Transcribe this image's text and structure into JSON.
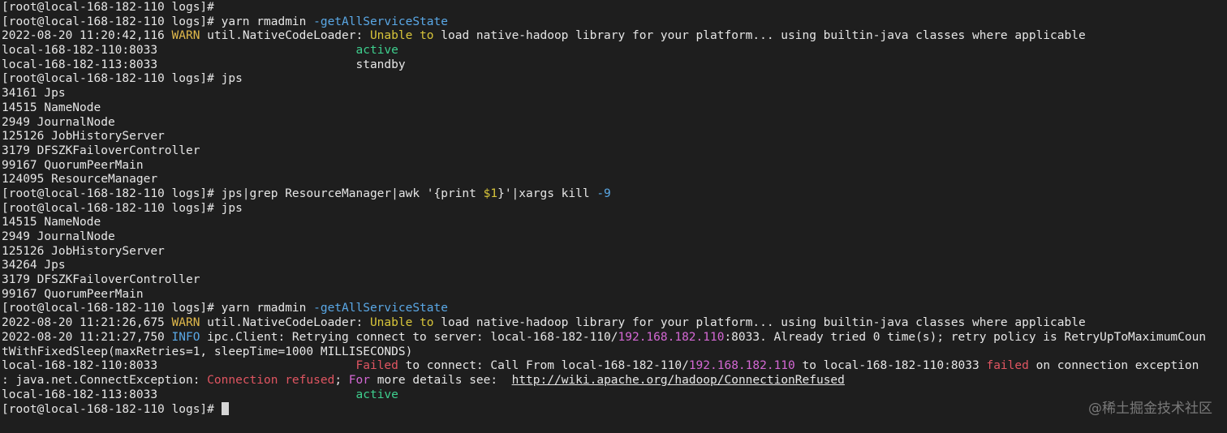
{
  "terminal": {
    "colors": {
      "background": "#1e1e1e",
      "text": "#e6e6e6",
      "warn": "#e0b84b",
      "flag": "#5aa8e6",
      "yellow": "#d8c53a",
      "green": "#3ecf8e",
      "magenta": "#d468d4",
      "red": "#e05561"
    },
    "lines": [
      [
        {
          "t": "[root@local-168-182-110 logs]#",
          "c": "default"
        }
      ],
      [
        {
          "t": "[root@local-168-182-110 logs]# yarn rmadmin ",
          "c": "default"
        },
        {
          "t": "-getAllServiceState",
          "c": "flag"
        }
      ],
      [
        {
          "t": "2022-08-20 11:20:42,116 ",
          "c": "default"
        },
        {
          "t": "WARN",
          "c": "warn"
        },
        {
          "t": " util.NativeCodeLoader: ",
          "c": "default"
        },
        {
          "t": "Unable",
          "c": "yellow"
        },
        {
          "t": " ",
          "c": "default"
        },
        {
          "t": "to",
          "c": "yellow"
        },
        {
          "t": " load native-hadoop library for your platform... using builtin-java classes where applicable",
          "c": "default"
        }
      ],
      [
        {
          "t": "local-168-182-110:8033                            ",
          "c": "default"
        },
        {
          "t": "active",
          "c": "green"
        }
      ],
      [
        {
          "t": "local-168-182-113:8033                            standby",
          "c": "default"
        }
      ],
      [
        {
          "t": "[root@local-168-182-110 logs]# jps",
          "c": "default"
        }
      ],
      [
        {
          "t": "34161 Jps",
          "c": "default"
        }
      ],
      [
        {
          "t": "14515 NameNode",
          "c": "default"
        }
      ],
      [
        {
          "t": "2949 JournalNode",
          "c": "default"
        }
      ],
      [
        {
          "t": "125126 JobHistoryServer",
          "c": "default"
        }
      ],
      [
        {
          "t": "3179 DFSZKFailoverController",
          "c": "default"
        }
      ],
      [
        {
          "t": "99167 QuorumPeerMain",
          "c": "default"
        }
      ],
      [
        {
          "t": "124095 ResourceManager",
          "c": "default"
        }
      ],
      [
        {
          "t": "[root@local-168-182-110 logs]# jps|grep ResourceManager|awk '{print ",
          "c": "default"
        },
        {
          "t": "$1",
          "c": "yellow"
        },
        {
          "t": "}'|xargs kill ",
          "c": "default"
        },
        {
          "t": "-9",
          "c": "flag"
        }
      ],
      [
        {
          "t": "[root@local-168-182-110 logs]# jps",
          "c": "default"
        }
      ],
      [
        {
          "t": "14515 NameNode",
          "c": "default"
        }
      ],
      [
        {
          "t": "2949 JournalNode",
          "c": "default"
        }
      ],
      [
        {
          "t": "125126 JobHistoryServer",
          "c": "default"
        }
      ],
      [
        {
          "t": "34264 Jps",
          "c": "default"
        }
      ],
      [
        {
          "t": "3179 DFSZKFailoverController",
          "c": "default"
        }
      ],
      [
        {
          "t": "99167 QuorumPeerMain",
          "c": "default"
        }
      ],
      [
        {
          "t": "[root@local-168-182-110 logs]# yarn rmadmin ",
          "c": "default"
        },
        {
          "t": "-getAllServiceState",
          "c": "flag"
        }
      ],
      [
        {
          "t": "2022-08-20 11:21:26,675 ",
          "c": "default"
        },
        {
          "t": "WARN",
          "c": "warn"
        },
        {
          "t": " util.NativeCodeLoader: ",
          "c": "default"
        },
        {
          "t": "Unable",
          "c": "yellow"
        },
        {
          "t": " ",
          "c": "default"
        },
        {
          "t": "to",
          "c": "yellow"
        },
        {
          "t": " load native-hadoop library for your platform... using builtin-java classes where applicable",
          "c": "default"
        }
      ],
      [
        {
          "t": "2022-08-20 11:21:27,750 ",
          "c": "default"
        },
        {
          "t": "INFO",
          "c": "info"
        },
        {
          "t": " ipc.Client: Retrying connect to server: local-168-182-110/",
          "c": "default"
        },
        {
          "t": "192.168.182.110",
          "c": "magenta"
        },
        {
          "t": ":8033. Already tried 0 time(s); retry policy is RetryUpToMaximumCoun",
          "c": "default"
        }
      ],
      [
        {
          "t": "tWithFixedSleep(maxRetries=1, sleepTime=1000 MILLISECONDS)",
          "c": "default"
        }
      ],
      [
        {
          "t": "local-168-182-110:8033                            ",
          "c": "default"
        },
        {
          "t": "Failed",
          "c": "red"
        },
        {
          "t": " to connect: Call From local-168-182-110/",
          "c": "default"
        },
        {
          "t": "192.168.182.110",
          "c": "magenta"
        },
        {
          "t": " to local-168-182-110:8033 ",
          "c": "default"
        },
        {
          "t": "failed",
          "c": "red"
        },
        {
          "t": " on connection exception",
          "c": "default"
        }
      ],
      [
        {
          "t": ": java.net.ConnectException: ",
          "c": "default"
        },
        {
          "t": "Connection refused",
          "c": "red"
        },
        {
          "t": "; ",
          "c": "default"
        },
        {
          "t": "For",
          "c": "magenta"
        },
        {
          "t": " more details see:  ",
          "c": "default"
        },
        {
          "t": "http://wiki.apache.org/hadoop/ConnectionRefused",
          "c": "link"
        }
      ],
      [
        {
          "t": "local-168-182-113:8033                            ",
          "c": "default"
        },
        {
          "t": "active",
          "c": "green"
        }
      ],
      [
        {
          "t": "[root@local-168-182-110 logs]# ",
          "c": "default"
        },
        {
          "t": "",
          "c": "cursor"
        }
      ]
    ]
  },
  "watermark": "@稀土掘金技术社区"
}
